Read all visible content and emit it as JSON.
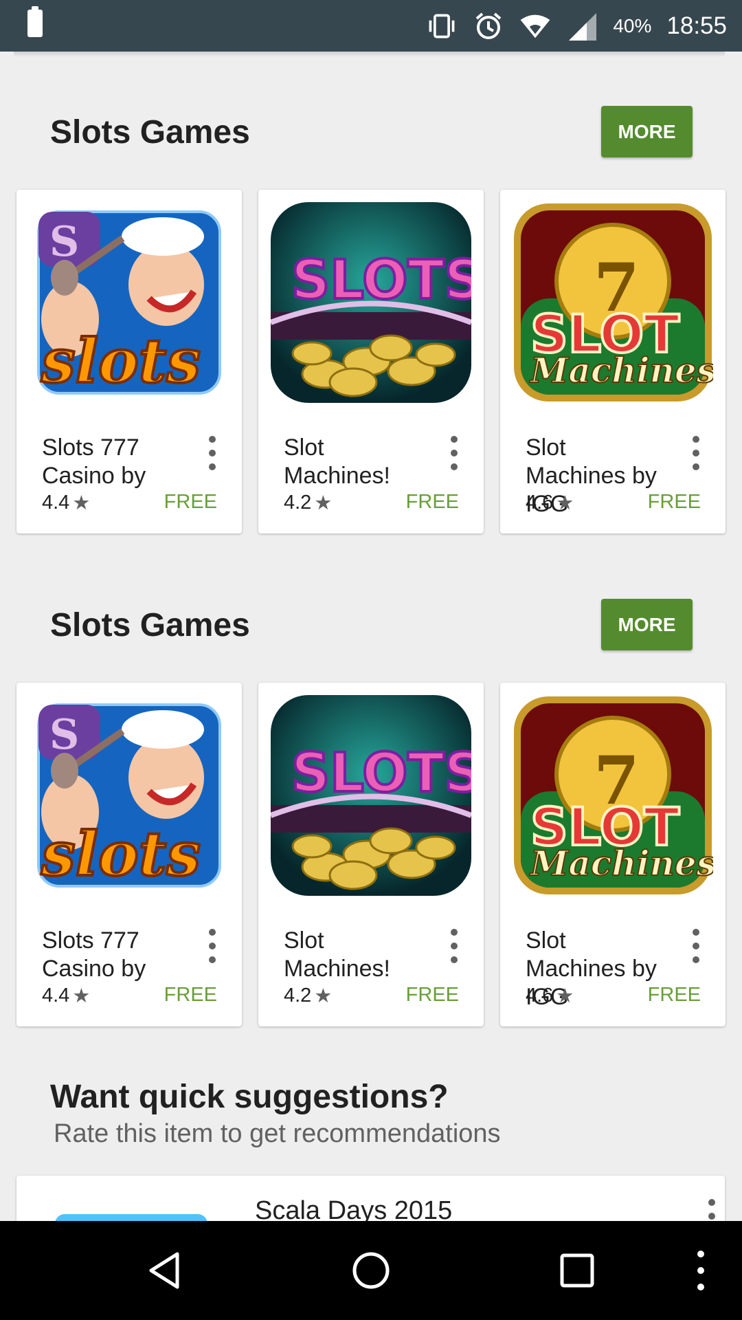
{
  "status_bar": {
    "battery_percent": "40%",
    "time": "18:55",
    "icons": [
      "battery-icon",
      "vibrate-icon",
      "alarm-icon",
      "wifi-icon",
      "cell-signal-icon"
    ]
  },
  "sections": [
    {
      "title": "Slots Games",
      "more_label": "MORE",
      "apps": [
        {
          "name": "Slots 777 Casino by",
          "rating": "4.4",
          "price": "FREE",
          "icon": "popeye-slots-icon"
        },
        {
          "name": "Slot Machines!",
          "rating": "4.2",
          "price": "FREE",
          "icon": "slots-coins-icon"
        },
        {
          "name": "Slot Machines by IGG",
          "rating": "4.6",
          "price": "FREE",
          "icon": "slot-machines-777-icon"
        }
      ]
    },
    {
      "title": "Slots Games",
      "more_label": "MORE",
      "apps": [
        {
          "name": "Slots 777 Casino by",
          "rating": "4.4",
          "price": "FREE",
          "icon": "popeye-slots-icon"
        },
        {
          "name": "Slot Machines!",
          "rating": "4.2",
          "price": "FREE",
          "icon": "slots-coins-icon"
        },
        {
          "name": "Slot Machines by IGG",
          "rating": "4.6",
          "price": "FREE",
          "icon": "slot-machines-777-icon"
        }
      ]
    }
  ],
  "suggestions": {
    "title": "Want quick suggestions?",
    "subtitle": "Rate this item to get recommendations",
    "item_name": "Scala Days 2015"
  },
  "nav_bar": {
    "buttons": [
      "back-icon",
      "home-icon",
      "recents-icon",
      "menu-icon"
    ]
  },
  "icon_art": {
    "slots_text": "slots",
    "slots_banner": "SLOTS",
    "seven": "7",
    "slot_word": "SLOT",
    "machines_word": "Machines",
    "s_badge": "S"
  },
  "colors": {
    "status_bar": "#37474f",
    "more_button": "#558b2f",
    "price_text": "#689f38",
    "background": "#eeeeee"
  }
}
